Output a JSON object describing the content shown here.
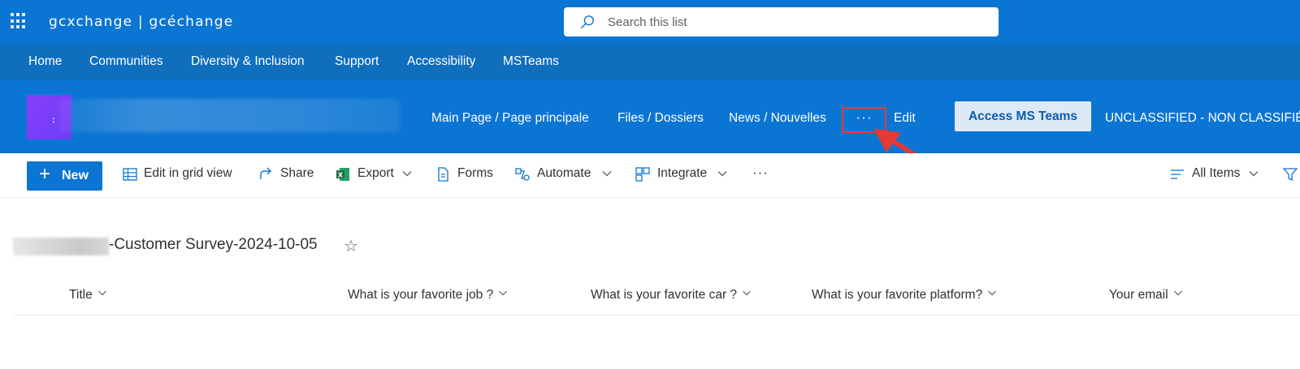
{
  "suite_bar": {
    "brand": "gcxchange | gcéchange",
    "search_placeholder": "Search this list",
    "background": "#0b75d3"
  },
  "hub_nav": {
    "items": [
      "Home",
      "Communities",
      "Diversity & Inclusion",
      "Support",
      "Accessibility",
      "MSTeams"
    ],
    "background": "#106ebe"
  },
  "site_header": {
    "nav": [
      "Main Page / Page principale",
      "Files / Dossiers",
      "News / Nouvelles"
    ],
    "more_label": "···",
    "edit_label": "Edit",
    "access_button": "Access MS Teams",
    "classification": "UNCLASSIFIED - NON CLASSIFIÉ",
    "logo_text": ":"
  },
  "command_bar": {
    "new_label": "New",
    "edit_grid_label": "Edit in grid view",
    "share_label": "Share",
    "export_label": "Export",
    "forms_label": "Forms",
    "automate_label": "Automate",
    "integrate_label": "Integrate",
    "more_label": "···",
    "view_label": "All Items"
  },
  "list": {
    "title": "-Customer Survey-2024-10-05",
    "columns": [
      "Title",
      "What is your favorite job ?",
      "What is your favorite car ?",
      "What is your favorite platform?",
      "Your email"
    ]
  },
  "colors": {
    "accent": "#0b75d3",
    "highlight": "#e53935",
    "excel_green": "#1d6f42"
  }
}
